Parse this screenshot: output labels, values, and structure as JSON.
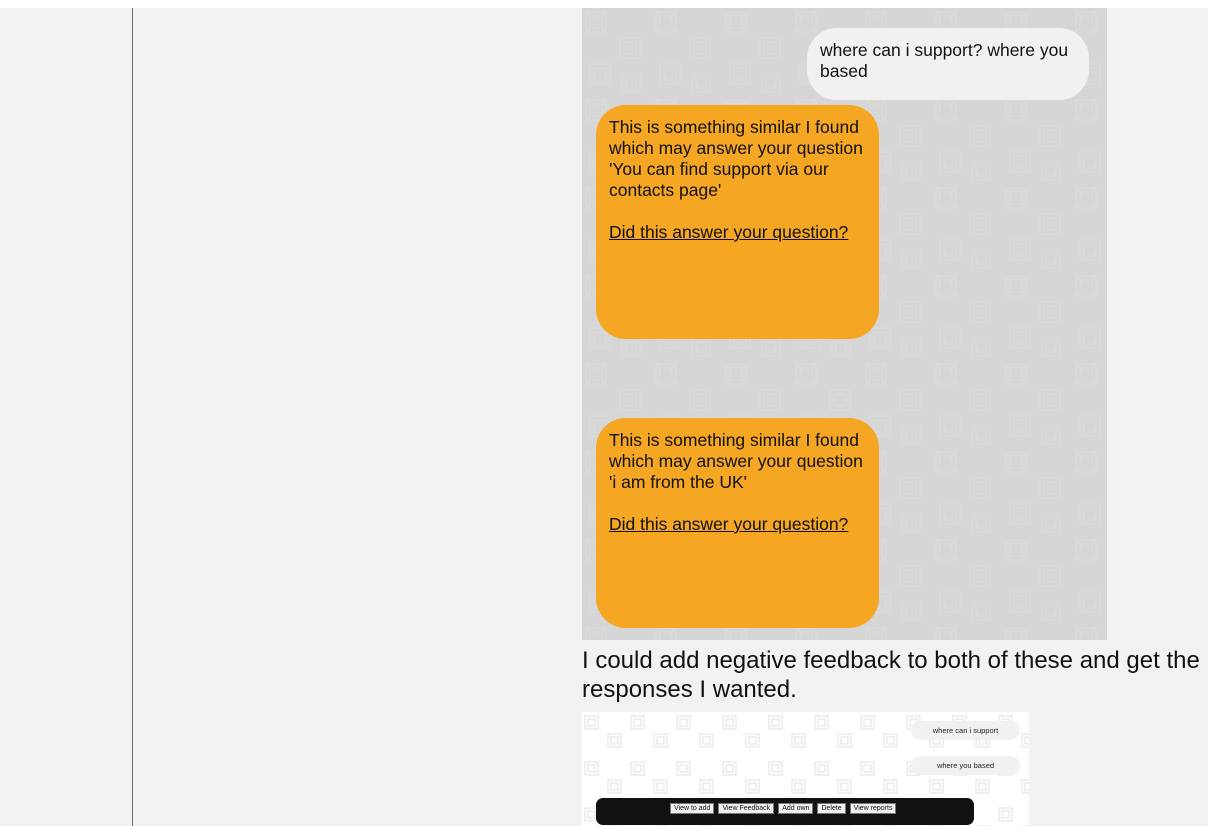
{
  "chat": {
    "user_message": "where can i support? where you based",
    "bot_messages": [
      {
        "text": "This is something similar I found which may answer your question 'You can find support via our contacts page'",
        "link": "Did this answer your question?"
      },
      {
        "text": "This is something similar I found which may answer your question 'i am from the UK'",
        "link": "Did this answer your question?"
      }
    ]
  },
  "caption": "I could add negative feedback to both of these and get the responses I wanted.",
  "second_chat": {
    "user_messages": [
      "where can i support",
      "where you based"
    ],
    "toolbar_buttons": [
      "View to add",
      "View Feedback",
      "Add own",
      "Delete",
      "View reports"
    ]
  },
  "colors": {
    "bot_bubble": "#f5a623",
    "user_bubble": "#f1f1f1",
    "toolbar": "#111111",
    "page_background": "#f2f2f2"
  }
}
